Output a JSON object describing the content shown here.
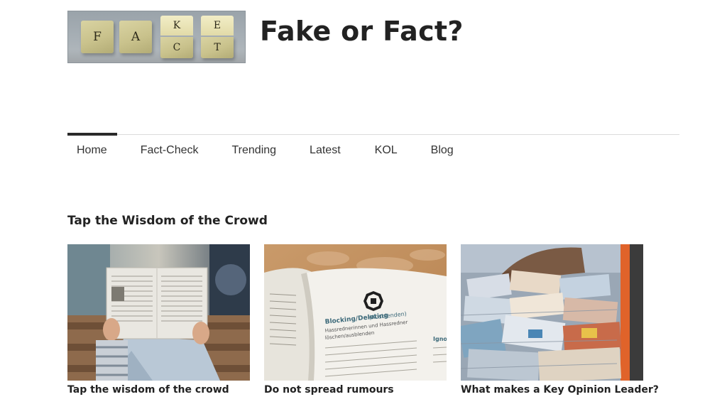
{
  "site": {
    "title": "Fake or Fact?",
    "logo": {
      "cubes": [
        "F",
        "A"
      ],
      "stacked": [
        {
          "top": "K",
          "bottom": "C"
        },
        {
          "top": "E",
          "bottom": "T"
        }
      ]
    }
  },
  "nav": {
    "active": "Home",
    "items": [
      "Home",
      "Fact-Check",
      "Trending",
      "Latest",
      "KOL",
      "Blog"
    ]
  },
  "section": {
    "title": "Tap the Wisdom of the Crowd",
    "cards": [
      {
        "caption": "Tap the wisdom of the crowd",
        "image": "person-reading-newspaper"
      },
      {
        "caption": "Do not spread rumours",
        "image": "open-book-blocking-deleting"
      },
      {
        "caption": "What makes a Key Opinion Leader?",
        "image": "stacks-of-newspapers"
      }
    ]
  },
  "book_text": {
    "heading": "Blocking/Deleting",
    "heading_paren": "(Ausblenden)",
    "sub1": "Hassrednerinnen und Hassredner",
    "sub2": "löschen/ausblenden",
    "side": "Igno"
  }
}
